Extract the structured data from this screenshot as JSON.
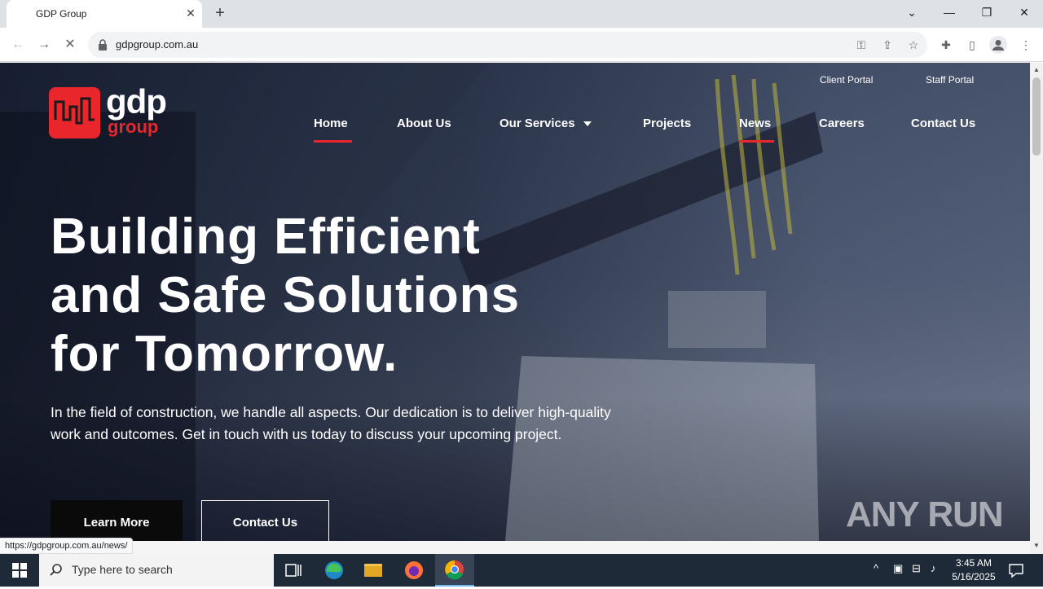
{
  "browser": {
    "tab_title": "GDP Group",
    "url": "gdpgroup.com.au",
    "status_url": "https://gdpgroup.com.au/news/"
  },
  "site": {
    "logo_primary": "gdp",
    "logo_secondary": "group",
    "top_links": [
      "Client Portal",
      "Staff Portal"
    ],
    "nav": {
      "home": "Home",
      "about": "About Us",
      "services": "Our Services",
      "projects": "Projects",
      "news": "News",
      "careers": "Careers",
      "contact": "Contact Us"
    },
    "active_nav": "Home",
    "hovered_nav": "News",
    "accent_color": "#e8262b",
    "hero": {
      "headline_line1": "Building Efficient",
      "headline_line2": "and Safe Solutions",
      "headline_line3": "for Tomorrow.",
      "subtext": "In the field of construction, we handle all aspects. Our dedication is to deliver high-quality work and outcomes. Get in touch with us today to discuss your upcoming project.",
      "primary_button": "Learn More",
      "secondary_button": "Contact Us"
    },
    "watermark": "ANY RUN"
  },
  "taskbar": {
    "search_placeholder": "Type here to search",
    "time": "3:45 AM",
    "date": "5/16/2025"
  }
}
